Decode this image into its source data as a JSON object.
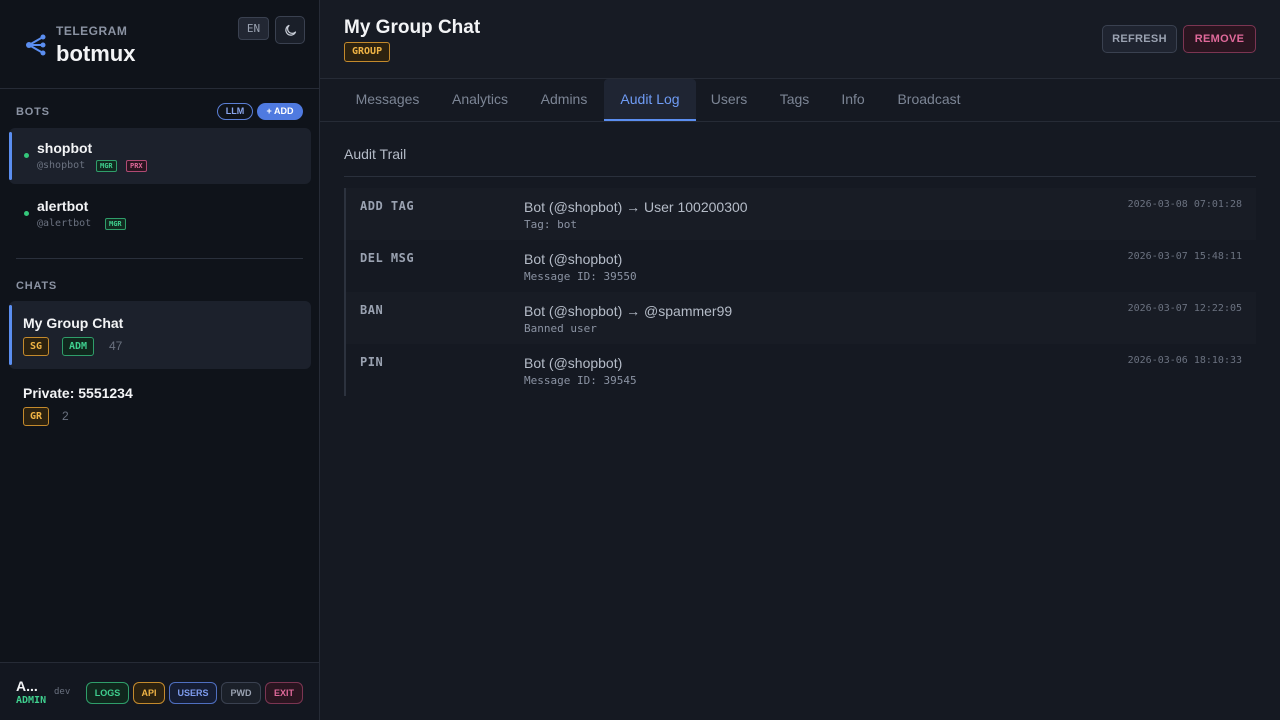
{
  "brand": {
    "subtitle": "TELEGRAM",
    "name": "botmux",
    "lang": "EN"
  },
  "sidebar": {
    "bots_label": "BOTS",
    "llm_label": "LLM",
    "add_label": "+ ADD",
    "bots": [
      {
        "name": "shopbot",
        "handle": "@shopbot",
        "tags": [
          "MGR",
          "PRX"
        ]
      },
      {
        "name": "alertbot",
        "handle": "@alertbot",
        "tags": [
          "MGR"
        ]
      }
    ],
    "chats_label": "CHATS",
    "chats": [
      {
        "name": "My Group Chat",
        "tags": [
          "SG",
          "ADM"
        ],
        "count": "47"
      },
      {
        "name": "Private: 5551234",
        "tags": [
          "GR"
        ],
        "count": "2"
      }
    ]
  },
  "footer": {
    "user": "A...",
    "role": "ADMIN",
    "env": "dev",
    "buttons": {
      "logs": "LOGS",
      "api": "API",
      "users": "USERS",
      "pwd": "PWD",
      "exit": "EXIT"
    }
  },
  "header": {
    "title": "My Group Chat",
    "badge": "GROUP",
    "refresh": "REFRESH",
    "remove": "REMOVE"
  },
  "tabs": [
    "Messages",
    "Analytics",
    "Admins",
    "Audit Log",
    "Users",
    "Tags",
    "Info",
    "Broadcast"
  ],
  "active_tab": "Audit Log",
  "audit": {
    "title": "Audit Trail",
    "rows": [
      {
        "action": "ADD TAG",
        "summary": "Bot (@shopbot) → User 100200300",
        "detail": "Tag: bot",
        "time": "2026-03-08 07:01:28"
      },
      {
        "action": "DEL MSG",
        "summary": "Bot (@shopbot)",
        "detail": "Message ID: 39550",
        "time": "2026-03-07 15:48:11"
      },
      {
        "action": "BAN",
        "summary": "Bot (@shopbot) → @spammer99",
        "detail": "Banned user",
        "time": "2026-03-07 12:22:05"
      },
      {
        "action": "PIN",
        "summary": "Bot (@shopbot)",
        "detail": "Message ID: 39545",
        "time": "2026-03-06 18:10:33"
      }
    ]
  },
  "colors": {
    "accent": "#5b8ef0",
    "online": "#34c77b",
    "danger": "#e0699a",
    "warning": "#f0b445"
  }
}
